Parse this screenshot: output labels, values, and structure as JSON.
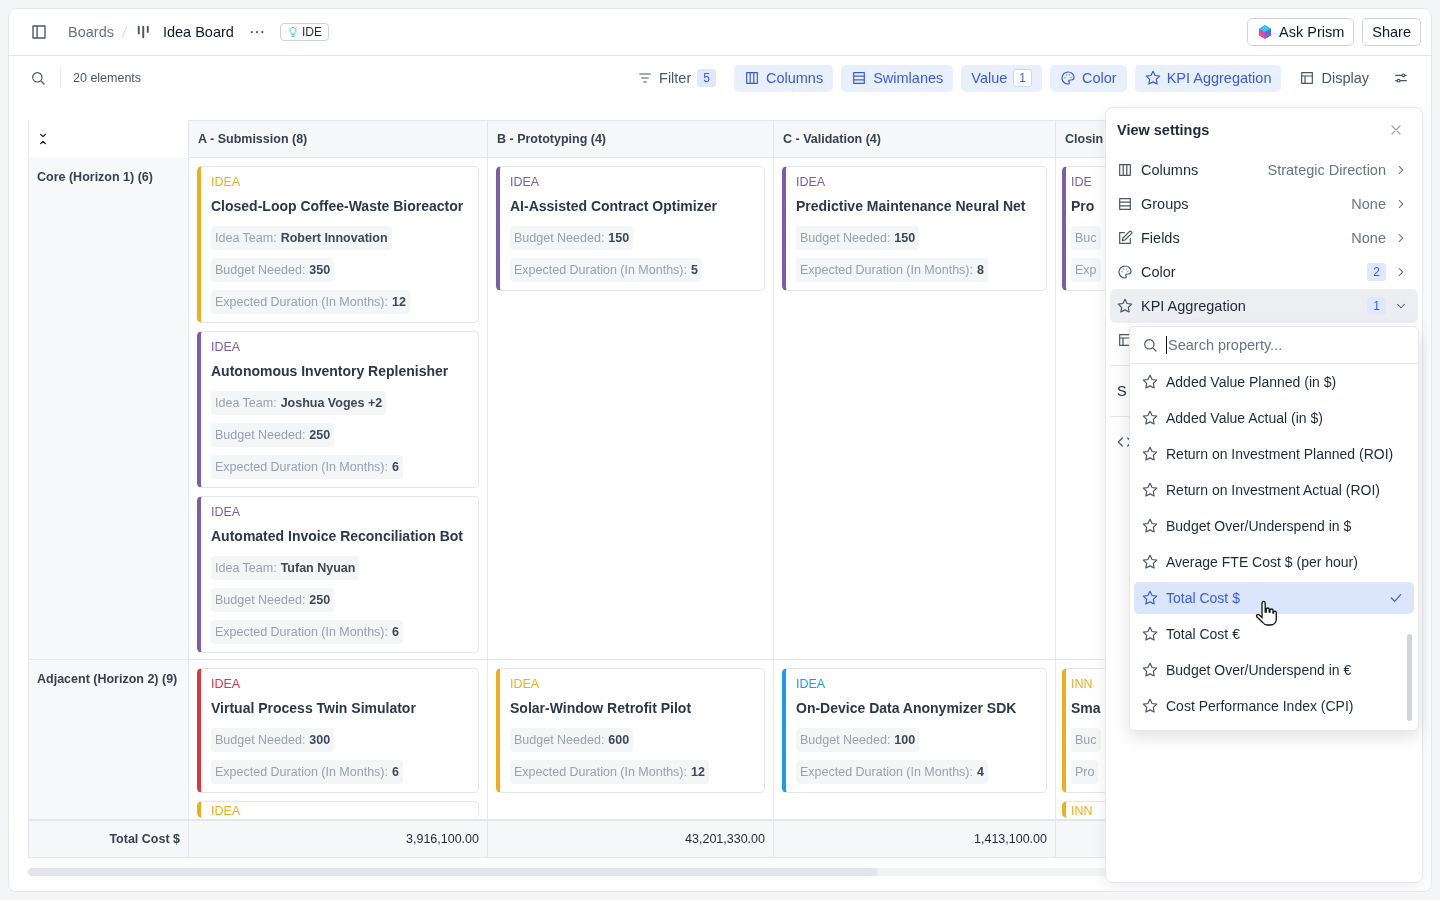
{
  "topbar": {
    "breadcrumb": [
      {
        "label": "Boards"
      },
      {
        "label": "Idea Board"
      }
    ],
    "tag": "IDE",
    "buttons": [
      {
        "kind": "prism",
        "label": "Ask Prism"
      },
      {
        "kind": "plain",
        "label": "Share"
      }
    ]
  },
  "toolbar": {
    "count": "20 elements",
    "controls": [
      {
        "kind": "filter",
        "label": "Filter",
        "badge": "5",
        "active": false
      },
      {
        "kind": "columns",
        "label": "Columns",
        "active": true
      },
      {
        "kind": "swimlanes",
        "label": "Swimlanes",
        "active": true
      },
      {
        "kind": "value",
        "label": "Value",
        "badge": "1",
        "active": true
      },
      {
        "kind": "color",
        "label": "Color",
        "active": true
      },
      {
        "kind": "kpi",
        "label": "KPI Aggregation",
        "active": true
      },
      {
        "kind": "display",
        "label": "Display",
        "active": false
      }
    ]
  },
  "board": {
    "columns": [
      {
        "title": "A - Submission (8)"
      },
      {
        "title": "B - Prototyping (4)"
      },
      {
        "title": "C - Validation (4)"
      },
      {
        "title": "Closin"
      }
    ],
    "lanes": [
      {
        "title": "Core (Horizon 1) (6)",
        "cells": [
          [
            {
              "label": "IDEA",
              "color": "#f0ad1e",
              "title": "Closed-Loop Coffee-Waste Bioreactor",
              "fields": [
                {
                  "name": "Idea Team:",
                  "value": "Robert Innovation"
                },
                {
                  "name": "Budget Needed:",
                  "value": "350"
                },
                {
                  "name": "Expected Duration (In Months):",
                  "value": "12"
                }
              ]
            },
            {
              "label": "IDEA",
              "color": "#7b5ea7",
              "title": "Autonomous Inventory Replenisher",
              "fields": [
                {
                  "name": "Idea Team:",
                  "value": "Joshua Voges +2"
                },
                {
                  "name": "Budget Needed:",
                  "value": "250"
                },
                {
                  "name": "Expected Duration (In Months):",
                  "value": "6"
                }
              ]
            },
            {
              "label": "IDEA",
              "color": "#7b5ea7",
              "title": "Automated Invoice Reconciliation Bot",
              "fields": [
                {
                  "name": "Idea Team:",
                  "value": "Tufan Nyuan"
                },
                {
                  "name": "Budget Needed:",
                  "value": "250"
                },
                {
                  "name": "Expected Duration (In Months):",
                  "value": "6"
                }
              ]
            }
          ],
          [
            {
              "label": "IDEA",
              "color": "#7b5ea7",
              "title": "AI-Assisted Contract Optimizer",
              "fields": [
                {
                  "name": "Budget Needed:",
                  "value": "150"
                },
                {
                  "name": "Expected Duration (In Months):",
                  "value": "5"
                }
              ]
            }
          ],
          [
            {
              "label": "IDEA",
              "color": "#7b5ea7",
              "title": "Predictive Maintenance Neural Net",
              "fields": [
                {
                  "name": "Budget Needed:",
                  "value": "150"
                },
                {
                  "name": "Expected Duration (In Months):",
                  "value": "8"
                }
              ]
            }
          ],
          [
            {
              "label": "IDE",
              "color": "#7b5ea7",
              "title": "Pro",
              "fields": [
                {
                  "name": "Buc"
                },
                {
                  "name": "Exp"
                }
              ]
            }
          ]
        ]
      },
      {
        "title": "Adjacent (Horizon 2) (9)",
        "cells": [
          [
            {
              "label": "IDEA",
              "color": "#dc3545",
              "title": "Virtual Process Twin Simulator",
              "fields": [
                {
                  "name": "Budget Needed:",
                  "value": "300"
                },
                {
                  "name": "Expected Duration (In Months):",
                  "value": "6"
                }
              ]
            },
            {
              "label": "IDEA",
              "color": "#f0ad1e"
            }
          ],
          [
            {
              "label": "IDEA",
              "color": "#f0ad1e",
              "title": "Solar-Window Retrofit Pilot",
              "fields": [
                {
                  "name": "Budget Needed:",
                  "value": "600"
                },
                {
                  "name": "Expected Duration (In Months):",
                  "value": "12"
                }
              ]
            }
          ],
          [
            {
              "label": "IDEA",
              "color": "#1a9bf0",
              "title": "On-Device Data Anonymizer SDK",
              "fields": [
                {
                  "name": "Budget Needed:",
                  "value": "100"
                },
                {
                  "name": "Expected Duration (In Months):",
                  "value": "4"
                }
              ]
            }
          ],
          [
            {
              "label": "INN",
              "color": "#f0ad1e",
              "title": "Sma",
              "fields": [
                {
                  "name": "Buc"
                },
                {
                  "name": "Pro"
                }
              ]
            },
            {
              "label": "INN",
              "color": "#f0ad1e"
            }
          ]
        ]
      }
    ],
    "totals": {
      "label": "Total Cost $",
      "values": [
        "3,916,100.00",
        "43,201,330.00",
        "1,413,100.00"
      ]
    }
  },
  "panel": {
    "title": "View settings",
    "rows": [
      {
        "kind": "columns",
        "label": "Columns",
        "value": "Strategic Direction",
        "expanded": false
      },
      {
        "kind": "groups",
        "label": "Groups",
        "value": "None",
        "expanded": false
      },
      {
        "kind": "fields",
        "label": "Fields",
        "value": "None",
        "expanded": false
      },
      {
        "kind": "color",
        "label": "Color",
        "badge": "2",
        "expanded": false
      },
      {
        "kind": "kpi",
        "label": "KPI Aggregation",
        "badge": "1",
        "expanded": true
      }
    ],
    "covered_rows": [
      {
        "kind": "layout"
      },
      {
        "kind": "text",
        "label": "S"
      },
      {
        "kind": "code"
      }
    ],
    "dropdown": {
      "placeholder": "Search property...",
      "items": [
        {
          "label": "Added Value Planned (in $)",
          "selected": false
        },
        {
          "label": "Added Value Actual (in $)",
          "selected": false
        },
        {
          "label": "Return on Investment Planned (ROI)",
          "selected": false
        },
        {
          "label": "Return on Investment Actual (ROI)",
          "selected": false
        },
        {
          "label": "Budget Over/Underspend in $",
          "selected": false
        },
        {
          "label": "Average FTE Cost $ (per hour)",
          "selected": false
        },
        {
          "label": "Total Cost $",
          "selected": true
        },
        {
          "label": "Total Cost €",
          "selected": false
        },
        {
          "label": "Budget Over/Underspend in €",
          "selected": false
        },
        {
          "label": "Cost Performance Index (CPI)",
          "selected": false
        }
      ]
    }
  }
}
